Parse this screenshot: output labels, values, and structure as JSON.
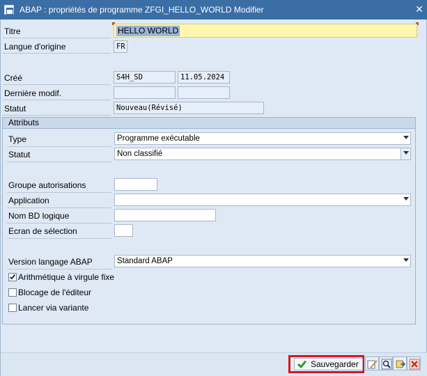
{
  "window": {
    "title": "ABAP : propriétés de programme ZFGI_HELLO_WORLD Modifier"
  },
  "header_fields": {
    "titre_label": "Titre",
    "titre_value": "HELLO WORLD",
    "langue_label": "Langue d'origine",
    "langue_value": "FR",
    "cree_label": "Créé",
    "cree_user": "S4H_SD",
    "cree_date": "11.05.2024",
    "modif_label": "Dernière modif.",
    "modif_user": "",
    "modif_date": "",
    "statut_label": "Statut",
    "statut_value": "Nouveau(Révisé)"
  },
  "attributes": {
    "group_title": "Attributs",
    "type_label": "Type",
    "type_value": "Programme exécutable",
    "statut_label": "Statut",
    "statut_value": "Non classifié",
    "groupe_label": "Groupe autorisations",
    "groupe_value": "",
    "application_label": "Application",
    "application_value": "",
    "nombd_label": "Nom BD logique",
    "nombd_value": "",
    "ecran_label": "Ecran de sélection",
    "ecran_value": "",
    "version_label": "Version langage ABAP",
    "version_value": "Standard ABAP",
    "checkboxes": [
      {
        "label": "Arithmétique à virgule fixe",
        "checked": true
      },
      {
        "label": "Blocage de l'éditeur",
        "checked": false
      },
      {
        "label": "Lancer via variante",
        "checked": false
      }
    ]
  },
  "footer": {
    "save_label": "Sauvegarder",
    "icons": [
      "check-icon",
      "edit-source-icon",
      "search-icon",
      "transport-icon",
      "cancel-icon"
    ]
  },
  "colors": {
    "titlebar": "#3a6ea5",
    "background": "#dfe9f5",
    "highlight_field": "#fff6b0",
    "save_border": "#d8141c"
  }
}
